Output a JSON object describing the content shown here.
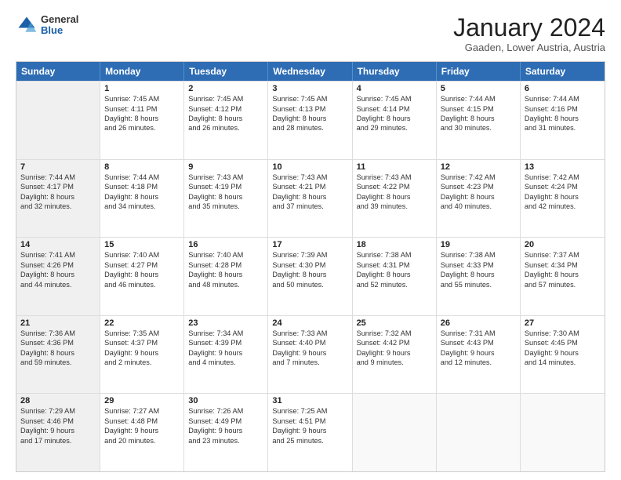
{
  "header": {
    "logo": {
      "general": "General",
      "blue": "Blue"
    },
    "title": "January 2024",
    "subtitle": "Gaaden, Lower Austria, Austria"
  },
  "days": [
    "Sunday",
    "Monday",
    "Tuesday",
    "Wednesday",
    "Thursday",
    "Friday",
    "Saturday"
  ],
  "rows": [
    [
      {
        "num": "",
        "sunrise": "",
        "sunset": "",
        "daylight": "",
        "shaded": true
      },
      {
        "num": "1",
        "sunrise": "Sunrise: 7:45 AM",
        "sunset": "Sunset: 4:11 PM",
        "daylight": "Daylight: 8 hours and 26 minutes."
      },
      {
        "num": "2",
        "sunrise": "Sunrise: 7:45 AM",
        "sunset": "Sunset: 4:12 PM",
        "daylight": "Daylight: 8 hours and 26 minutes."
      },
      {
        "num": "3",
        "sunrise": "Sunrise: 7:45 AM",
        "sunset": "Sunset: 4:13 PM",
        "daylight": "Daylight: 8 hours and 28 minutes."
      },
      {
        "num": "4",
        "sunrise": "Sunrise: 7:45 AM",
        "sunset": "Sunset: 4:14 PM",
        "daylight": "Daylight: 8 hours and 29 minutes."
      },
      {
        "num": "5",
        "sunrise": "Sunrise: 7:44 AM",
        "sunset": "Sunset: 4:15 PM",
        "daylight": "Daylight: 8 hours and 30 minutes."
      },
      {
        "num": "6",
        "sunrise": "Sunrise: 7:44 AM",
        "sunset": "Sunset: 4:16 PM",
        "daylight": "Daylight: 8 hours and 31 minutes."
      }
    ],
    [
      {
        "num": "7",
        "sunrise": "Sunrise: 7:44 AM",
        "sunset": "Sunset: 4:17 PM",
        "daylight": "Daylight: 8 hours and 32 minutes.",
        "shaded": true
      },
      {
        "num": "8",
        "sunrise": "Sunrise: 7:44 AM",
        "sunset": "Sunset: 4:18 PM",
        "daylight": "Daylight: 8 hours and 34 minutes."
      },
      {
        "num": "9",
        "sunrise": "Sunrise: 7:43 AM",
        "sunset": "Sunset: 4:19 PM",
        "daylight": "Daylight: 8 hours and 35 minutes."
      },
      {
        "num": "10",
        "sunrise": "Sunrise: 7:43 AM",
        "sunset": "Sunset: 4:21 PM",
        "daylight": "Daylight: 8 hours and 37 minutes."
      },
      {
        "num": "11",
        "sunrise": "Sunrise: 7:43 AM",
        "sunset": "Sunset: 4:22 PM",
        "daylight": "Daylight: 8 hours and 39 minutes."
      },
      {
        "num": "12",
        "sunrise": "Sunrise: 7:42 AM",
        "sunset": "Sunset: 4:23 PM",
        "daylight": "Daylight: 8 hours and 40 minutes."
      },
      {
        "num": "13",
        "sunrise": "Sunrise: 7:42 AM",
        "sunset": "Sunset: 4:24 PM",
        "daylight": "Daylight: 8 hours and 42 minutes."
      }
    ],
    [
      {
        "num": "14",
        "sunrise": "Sunrise: 7:41 AM",
        "sunset": "Sunset: 4:26 PM",
        "daylight": "Daylight: 8 hours and 44 minutes.",
        "shaded": true
      },
      {
        "num": "15",
        "sunrise": "Sunrise: 7:40 AM",
        "sunset": "Sunset: 4:27 PM",
        "daylight": "Daylight: 8 hours and 46 minutes."
      },
      {
        "num": "16",
        "sunrise": "Sunrise: 7:40 AM",
        "sunset": "Sunset: 4:28 PM",
        "daylight": "Daylight: 8 hours and 48 minutes."
      },
      {
        "num": "17",
        "sunrise": "Sunrise: 7:39 AM",
        "sunset": "Sunset: 4:30 PM",
        "daylight": "Daylight: 8 hours and 50 minutes."
      },
      {
        "num": "18",
        "sunrise": "Sunrise: 7:38 AM",
        "sunset": "Sunset: 4:31 PM",
        "daylight": "Daylight: 8 hours and 52 minutes."
      },
      {
        "num": "19",
        "sunrise": "Sunrise: 7:38 AM",
        "sunset": "Sunset: 4:33 PM",
        "daylight": "Daylight: 8 hours and 55 minutes."
      },
      {
        "num": "20",
        "sunrise": "Sunrise: 7:37 AM",
        "sunset": "Sunset: 4:34 PM",
        "daylight": "Daylight: 8 hours and 57 minutes."
      }
    ],
    [
      {
        "num": "21",
        "sunrise": "Sunrise: 7:36 AM",
        "sunset": "Sunset: 4:36 PM",
        "daylight": "Daylight: 8 hours and 59 minutes.",
        "shaded": true
      },
      {
        "num": "22",
        "sunrise": "Sunrise: 7:35 AM",
        "sunset": "Sunset: 4:37 PM",
        "daylight": "Daylight: 9 hours and 2 minutes."
      },
      {
        "num": "23",
        "sunrise": "Sunrise: 7:34 AM",
        "sunset": "Sunset: 4:39 PM",
        "daylight": "Daylight: 9 hours and 4 minutes."
      },
      {
        "num": "24",
        "sunrise": "Sunrise: 7:33 AM",
        "sunset": "Sunset: 4:40 PM",
        "daylight": "Daylight: 9 hours and 7 minutes."
      },
      {
        "num": "25",
        "sunrise": "Sunrise: 7:32 AM",
        "sunset": "Sunset: 4:42 PM",
        "daylight": "Daylight: 9 hours and 9 minutes."
      },
      {
        "num": "26",
        "sunrise": "Sunrise: 7:31 AM",
        "sunset": "Sunset: 4:43 PM",
        "daylight": "Daylight: 9 hours and 12 minutes."
      },
      {
        "num": "27",
        "sunrise": "Sunrise: 7:30 AM",
        "sunset": "Sunset: 4:45 PM",
        "daylight": "Daylight: 9 hours and 14 minutes."
      }
    ],
    [
      {
        "num": "28",
        "sunrise": "Sunrise: 7:29 AM",
        "sunset": "Sunset: 4:46 PM",
        "daylight": "Daylight: 9 hours and 17 minutes.",
        "shaded": true
      },
      {
        "num": "29",
        "sunrise": "Sunrise: 7:27 AM",
        "sunset": "Sunset: 4:48 PM",
        "daylight": "Daylight: 9 hours and 20 minutes."
      },
      {
        "num": "30",
        "sunrise": "Sunrise: 7:26 AM",
        "sunset": "Sunset: 4:49 PM",
        "daylight": "Daylight: 9 hours and 23 minutes."
      },
      {
        "num": "31",
        "sunrise": "Sunrise: 7:25 AM",
        "sunset": "Sunset: 4:51 PM",
        "daylight": "Daylight: 9 hours and 25 minutes."
      },
      {
        "num": "",
        "sunrise": "",
        "sunset": "",
        "daylight": "",
        "empty": true
      },
      {
        "num": "",
        "sunrise": "",
        "sunset": "",
        "daylight": "",
        "empty": true
      },
      {
        "num": "",
        "sunrise": "",
        "sunset": "",
        "daylight": "",
        "empty": true
      }
    ]
  ]
}
